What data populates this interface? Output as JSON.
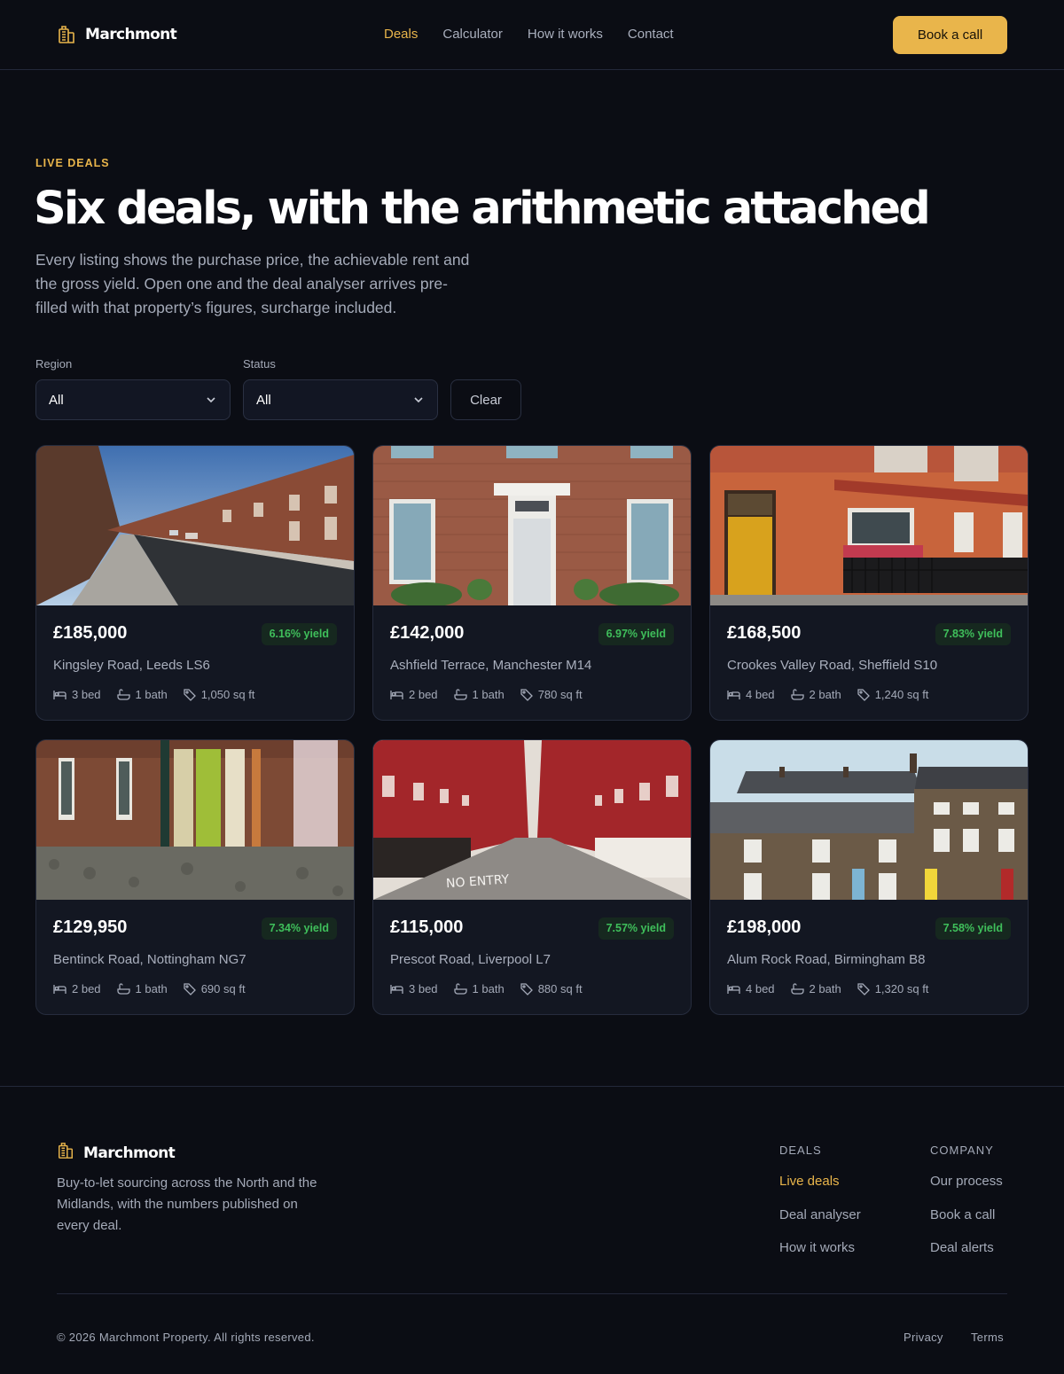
{
  "brand": {
    "name": "Marchmont",
    "accent": "#e9b54b",
    "background": "#0b0d14"
  },
  "nav": {
    "items": [
      {
        "label": "Deals",
        "active": true
      },
      {
        "label": "Calculator",
        "active": false
      },
      {
        "label": "How it works",
        "active": false
      },
      {
        "label": "Contact",
        "active": false
      }
    ],
    "cta_label": "Book a call"
  },
  "hero": {
    "eyebrow": "LIVE DEALS",
    "title": "Six deals, with the arithmetic attached",
    "lede": "Every listing shows the purchase price, the achievable rent and the gross yield. Open one and the deal analyser arrives pre-filled with that property’s figures, surcharge included."
  },
  "filters": {
    "region": {
      "label": "Region",
      "value": "All",
      "icon": "chevron-down-icon"
    },
    "status": {
      "label": "Status",
      "value": "All",
      "icon": "chevron-down-icon"
    },
    "clear_label": "Clear"
  },
  "deals": [
    {
      "price": "£185,000",
      "yield": "6.16% yield",
      "address": "Kingsley Road, Leeds LS6",
      "beds": "3 bed",
      "baths": "1 bath",
      "area": "1,050 sq ft",
      "photo": "terraced-street-photo"
    },
    {
      "price": "£142,000",
      "yield": "6.97% yield",
      "address": "Ashfield Terrace, Manchester M14",
      "beds": "2 bed",
      "baths": "1 bath",
      "area": "780 sq ft",
      "photo": "brick-house-front-door-photo"
    },
    {
      "price": "£168,500",
      "yield": "7.83% yield",
      "address": "Crookes Valley Road, Sheffield S10",
      "beds": "4 bed",
      "baths": "2 bath",
      "area": "1,240 sq ft",
      "photo": "red-brick-facade-yellow-door-photo"
    },
    {
      "price": "£129,950",
      "yield": "7.34% yield",
      "address": "Bentinck Road, Nottingham NG7",
      "beds": "2 bed",
      "baths": "1 bath",
      "area": "690 sq ft",
      "photo": "cobbled-terrace-photo"
    },
    {
      "price": "£115,000",
      "yield": "7.57% yield",
      "address": "Prescot Road, Liverpool L7",
      "beds": "3 bed",
      "baths": "1 bath",
      "area": "880 sq ft",
      "photo": "red-street-no-entry-photo"
    },
    {
      "price": "£198,000",
      "yield": "7.58% yield",
      "address": "Alum Rock Road, Birmingham B8",
      "beds": "4 bed",
      "baths": "2 bath",
      "area": "1,320 sq ft",
      "photo": "stone-terrace-row-photo"
    }
  ],
  "spec_icons": {
    "beds": "bed-icon",
    "baths": "bath-icon",
    "area": "tag-icon"
  },
  "footer": {
    "brand": "Marchmont",
    "description": "Buy-to-let sourcing across the North and the Midlands, with the numbers published on every deal.",
    "columns": [
      {
        "heading": "DEALS",
        "links": [
          {
            "label": "Live deals",
            "active": true
          },
          {
            "label": "Deal analyser",
            "active": false
          },
          {
            "label": "How it works",
            "active": false
          }
        ]
      },
      {
        "heading": "COMPANY",
        "links": [
          {
            "label": "Our process",
            "active": false
          },
          {
            "label": "Book a call",
            "active": false
          },
          {
            "label": "Deal alerts",
            "active": false
          }
        ]
      }
    ],
    "copyright": "© 2026 Marchmont Property. All rights reserved.",
    "legal": {
      "privacy": "Privacy",
      "terms": "Terms"
    }
  }
}
